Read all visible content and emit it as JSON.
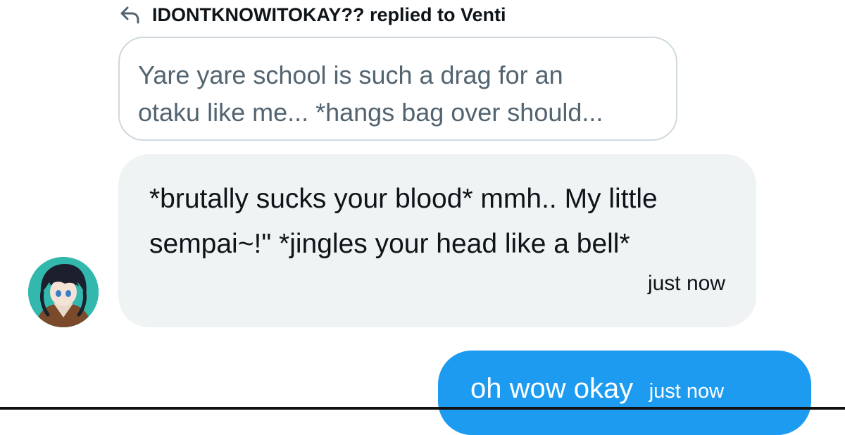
{
  "reply_context": {
    "icon": "reply-arrow-icon",
    "text": "IDONTKNOWITOKAY?? replied to Venti"
  },
  "quoted_message": {
    "line1": "Yare yare school is such a drag for an",
    "line2": "otaku like me... *hangs bag over should..."
  },
  "incoming_message": {
    "avatar": "user-avatar",
    "text": "*brutally sucks your blood* mmh.. My little sempai~!\" *jingles your head like a bell*",
    "time": "just now"
  },
  "outgoing_message": {
    "text": "oh wow okay",
    "time": "just now"
  },
  "colors": {
    "accent_blue": "#1d9bf0",
    "incoming_bubble": "#eff3f4",
    "quote_border": "#cfd9de",
    "quote_text": "#536471"
  }
}
